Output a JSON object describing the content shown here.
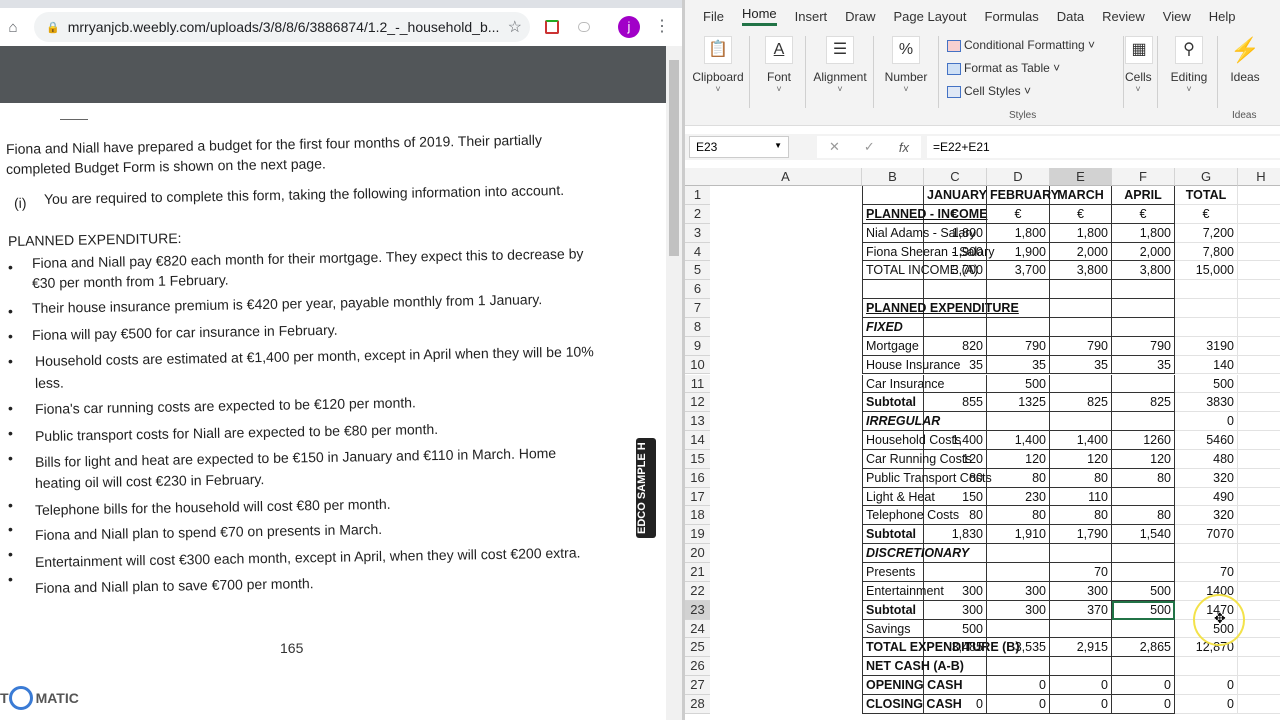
{
  "browser": {
    "url": "mrryanjcb.weebly.com/uploads/3/8/8/6/3886874/1.2_-_household_b...",
    "profile_initial": "j",
    "document": {
      "intro": [
        "Fiona and Niall have prepared a budget for the first four months of 2019. Their partially",
        "completed Budget Form is shown on the next page."
      ],
      "task_marker": "(i)",
      "task": "You are required to complete this form, taking the following information into account.",
      "section_heading": "PLANNED EXPENDITURE:",
      "bullets": [
        [
          "Fiona and Niall pay €820 each month for their mortgage. They expect this to decrease by",
          "€30 per month from 1 February."
        ],
        [
          "Their house insurance premium is €420 per year, payable monthly from 1 January."
        ],
        [
          "Fiona will pay €500 for car insurance in February."
        ],
        [
          "Household costs are estimated at €1,400 per month, except in April when they will be 10%",
          "less."
        ],
        [
          "Fiona's car running costs are expected to be €120 per month."
        ],
        [
          "Public transport costs for Niall are expected to be €80 per month."
        ],
        [
          "Bills for light and heat are expected to be €150 in January and €110 in March. Home",
          "heating oil will cost €230 in February."
        ],
        [
          "Telephone bills for the household will cost €80 per month."
        ],
        [
          "Fiona and Niall plan to spend €70 on presents in March."
        ],
        [
          "Entertainment will cost €300 each month, except in April, when they will cost €200 extra."
        ],
        [
          "Fiona and Niall plan to save €700 per month."
        ]
      ],
      "page_number": "165",
      "side_label": "EDCO SAMPLE H",
      "watermark": "MATIC"
    }
  },
  "excel": {
    "menu": [
      "File",
      "Home",
      "Insert",
      "Draw",
      "Page Layout",
      "Formulas",
      "Data",
      "Review",
      "View",
      "Help"
    ],
    "active_menu": "Home",
    "ribbon": {
      "clipboard": "Clipboard",
      "font": "Font",
      "alignment": "Alignment",
      "number": "Number",
      "conditional_formatting": "Conditional Formatting ˅",
      "format_as_table": "Format as Table ˅",
      "cell_styles": "Cell Styles ˅",
      "styles_group": "Styles",
      "cells": "Cells",
      "editing": "Editing",
      "ideas": "Ideas",
      "ideas_group": "Ideas"
    },
    "name_box": "E23",
    "formula": "=E22+E21",
    "columns": [
      "A",
      "B",
      "C",
      "D",
      "E",
      "F",
      "G",
      "H"
    ],
    "selected_cell": "E23",
    "accent": "#217346",
    "rows": [
      {
        "n": "1",
        "a": "",
        "v": [
          "JANUARY",
          "FEBRUARY",
          "MARCH",
          "APRIL",
          "TOTAL"
        ],
        "style": "hdr"
      },
      {
        "n": "2",
        "a": "PLANNED - INCOME",
        "v": [
          "€",
          "€",
          "€",
          "€",
          "€"
        ],
        "style": "u"
      },
      {
        "n": "3",
        "a": "Nial Adams - Salary",
        "v": [
          "1,800",
          "1,800",
          "1,800",
          "1,800",
          "7,200"
        ]
      },
      {
        "n": "4",
        "a": "Fiona Sheeran - Salary",
        "v": [
          "1,900",
          "1,900",
          "2,000",
          "2,000",
          "7,800"
        ]
      },
      {
        "n": "5",
        "a": "TOTAL INCOME (A)",
        "v": [
          "3,700",
          "3,700",
          "3,800",
          "3,800",
          "15,000"
        ]
      },
      {
        "n": "6",
        "a": "",
        "v": [
          "",
          "",
          "",
          "",
          ""
        ]
      },
      {
        "n": "7",
        "a": "PLANNED EXPENDITURE",
        "v": [
          "",
          "",
          "",
          "",
          ""
        ],
        "style": "u"
      },
      {
        "n": "8",
        "a": "FIXED",
        "v": [
          "",
          "",
          "",
          "",
          ""
        ],
        "style": "i"
      },
      {
        "n": "9",
        "a": "Mortgage",
        "v": [
          "820",
          "790",
          "790",
          "790",
          "3190"
        ]
      },
      {
        "n": "10",
        "a": "House Insurance",
        "v": [
          "35",
          "35",
          "35",
          "35",
          "140"
        ]
      },
      {
        "n": "11",
        "a": "Car Insurance",
        "v": [
          "",
          "500",
          "",
          "",
          "500"
        ]
      },
      {
        "n": "12",
        "a": "Subtotal",
        "v": [
          "855",
          "1325",
          "825",
          "825",
          "3830"
        ],
        "style": "b"
      },
      {
        "n": "13",
        "a": "IRREGULAR",
        "v": [
          "",
          "",
          "",
          "",
          "0"
        ],
        "style": "i"
      },
      {
        "n": "14",
        "a": "Household Costs",
        "v": [
          "1,400",
          "1,400",
          "1,400",
          "1260",
          "5460"
        ]
      },
      {
        "n": "15",
        "a": "Car Running Costs",
        "v": [
          "120",
          "120",
          "120",
          "120",
          "480"
        ]
      },
      {
        "n": "16",
        "a": "Public Transport Costs",
        "v": [
          "80",
          "80",
          "80",
          "80",
          "320"
        ]
      },
      {
        "n": "17",
        "a": "Light & Heat",
        "v": [
          "150",
          "230",
          "110",
          "",
          "490"
        ]
      },
      {
        "n": "18",
        "a": "Telephone Costs",
        "v": [
          "80",
          "80",
          "80",
          "80",
          "320"
        ]
      },
      {
        "n": "19",
        "a": "Subtotal",
        "v": [
          "1,830",
          "1,910",
          "1,790",
          "1,540",
          "7070"
        ],
        "style": "b"
      },
      {
        "n": "20",
        "a": "DISCRETIONARY",
        "v": [
          "",
          "",
          "",
          "",
          ""
        ],
        "style": "i"
      },
      {
        "n": "21",
        "a": "Presents",
        "v": [
          "",
          "",
          "70",
          "",
          "70"
        ]
      },
      {
        "n": "22",
        "a": "Entertainment",
        "v": [
          "300",
          "300",
          "300",
          "500",
          "1400"
        ]
      },
      {
        "n": "23",
        "a": "Subtotal",
        "v": [
          "300",
          "300",
          "370",
          "500",
          "1470"
        ],
        "style": "b"
      },
      {
        "n": "24",
        "a": "Savings",
        "v": [
          "500",
          "",
          "",
          "",
          "500"
        ]
      },
      {
        "n": "25",
        "a": "TOTAL EXPENDITURE (B)",
        "v": [
          "3,485",
          "3,535",
          "2,915",
          "2,865",
          "12,870"
        ],
        "style": "b"
      },
      {
        "n": "26",
        "a": "NET CASH (A-B)",
        "v": [
          "",
          "",
          "",
          "",
          ""
        ],
        "style": "b"
      },
      {
        "n": "27",
        "a": "OPENING CASH",
        "v": [
          "",
          "0",
          "0",
          "0",
          "0"
        ],
        "style": "b"
      },
      {
        "n": "28",
        "a": "CLOSING CASH",
        "v": [
          "0",
          "0",
          "0",
          "0",
          "0"
        ],
        "style": "b"
      }
    ]
  }
}
